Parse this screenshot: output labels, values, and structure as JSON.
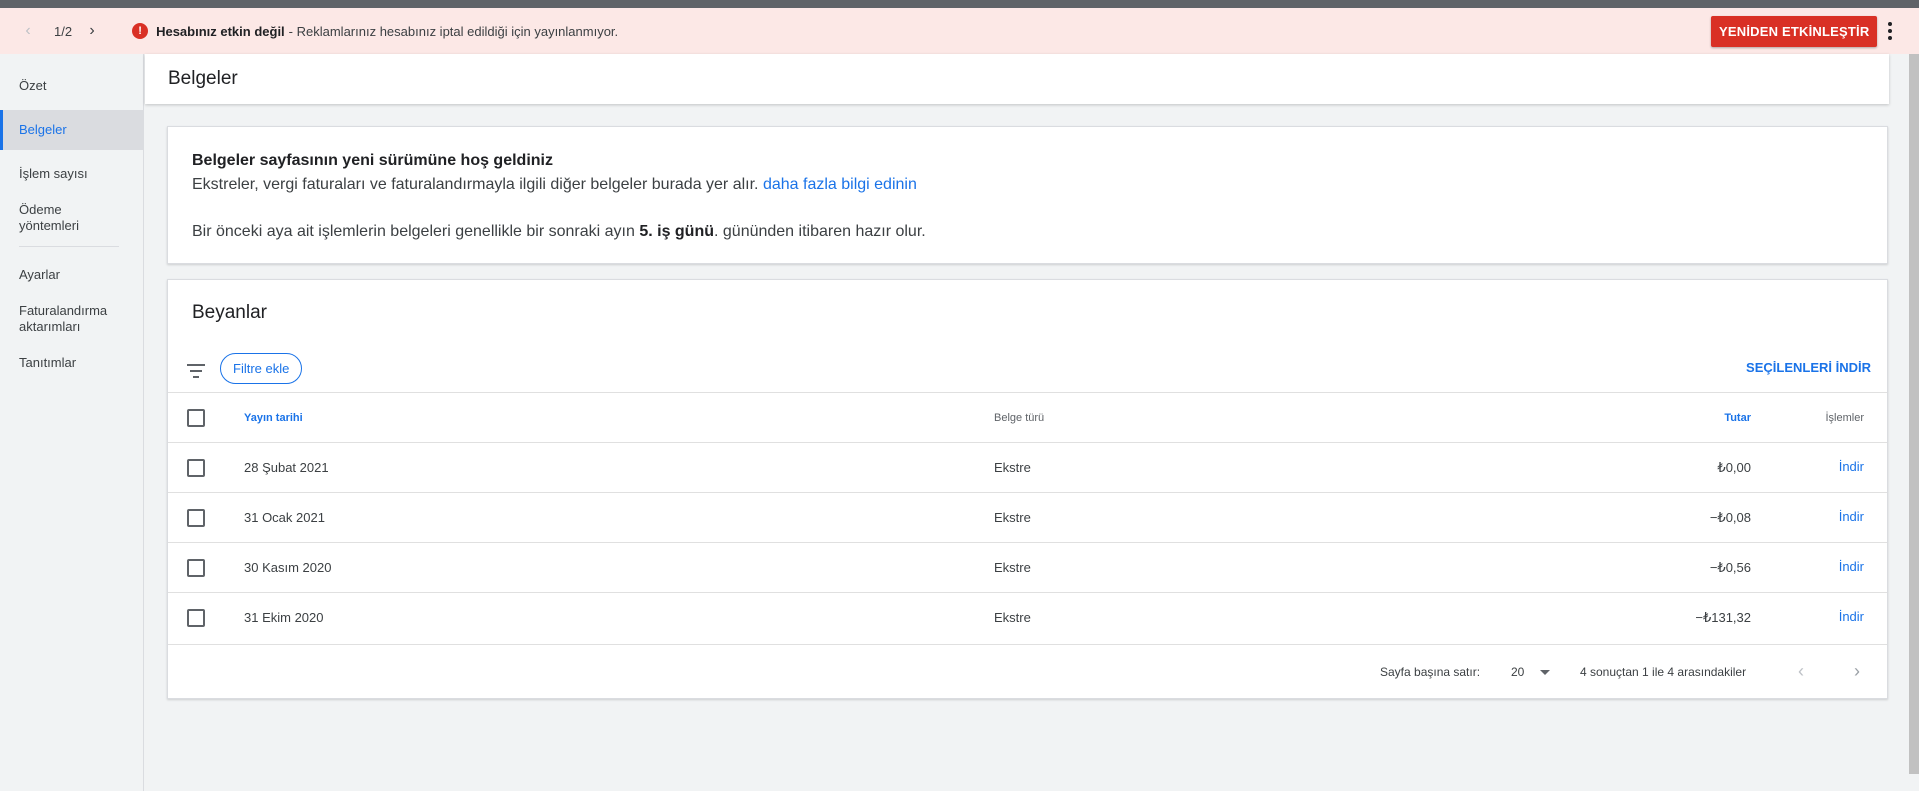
{
  "banner": {
    "pager": "1/2",
    "alert_title": "Hesabınız etkin değil",
    "alert_message": "- Reklamlarınız hesabınız iptal edildiği için yayınlanmıyor.",
    "reactivate_label": "YENİDEN ETKİNLEŞTİR"
  },
  "sidebar": {
    "items": [
      {
        "label": "Özet"
      },
      {
        "label": "Belgeler"
      },
      {
        "label": "İşlem sayısı"
      },
      {
        "label": "Ödeme yöntemleri"
      },
      {
        "label": "Ayarlar"
      },
      {
        "label": "Faturalandırma aktarımları"
      },
      {
        "label": "Tanıtımlar"
      }
    ],
    "active": "Belgeler"
  },
  "header": {
    "title": "Belgeler"
  },
  "welcome": {
    "title": "Belgeler sayfasının yeni sürümüne hoş geldiniz",
    "desc": "Ekstreler, vergi faturaları ve faturalandırmayla ilgili diğer belgeler burada yer alır.",
    "link": "daha fazla bilgi edinin",
    "note_prefix": "Bir önceki aya ait işlemlerin belgeleri genellikle bir sonraki ayın",
    "note_bold": "5. iş günü",
    "note_suffix": ". gününden itibaren hazır olur."
  },
  "statements": {
    "title": "Beyanlar",
    "filter_label": "Filtre ekle",
    "download_selected": "SEÇİLENLERİ İNDİR",
    "columns": {
      "date": "Yayın tarihi",
      "type": "Belge türü",
      "amount": "Tutar",
      "actions": "İşlemler"
    },
    "rows": [
      {
        "date": "28 Şubat 2021",
        "type": "Ekstre",
        "amount": "₺0,00",
        "action": "İndir"
      },
      {
        "date": "31 Ocak 2021",
        "type": "Ekstre",
        "amount": "−₺0,08",
        "action": "İndir"
      },
      {
        "date": "30 Kasım 2020",
        "type": "Ekstre",
        "amount": "−₺0,56",
        "action": "İndir"
      },
      {
        "date": "31 Ekim 2020",
        "type": "Ekstre",
        "amount": "−₺131,32",
        "action": "İndir"
      }
    ],
    "footer": {
      "rows_per_page_label": "Sayfa başına satır:",
      "rows_per_page_value": "20",
      "range": "4 sonuçtan 1 ile 4 arasındakiler"
    }
  },
  "colors": {
    "accent": "#1a73e8",
    "error": "#d93025",
    "banner_bg": "#fce8e6"
  }
}
